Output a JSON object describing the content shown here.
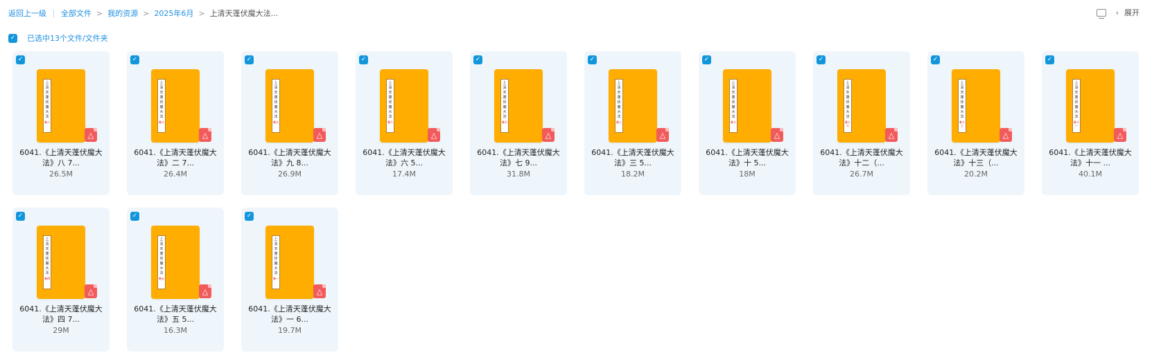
{
  "breadcrumb": {
    "back": "返回上一级",
    "items": [
      "全部文件",
      "我的资源",
      "2025年6月"
    ],
    "current": "上清天蓬伏魔大法..."
  },
  "toolbar": {
    "expand_label": "展开",
    "view_icon": "display-icon",
    "chevron_icon": "chevron-left-icon"
  },
  "selection": {
    "label": "已选中13个文件/文件夹",
    "checked": true
  },
  "colors": {
    "accent": "#1f8fe0",
    "checkbox": "#1296db",
    "card_bg": "#eef6fc",
    "book": "#ffad00",
    "pdf": "#f25b5b"
  },
  "files": [
    {
      "name_line1": "6041.《上清天蓬伏魔大",
      "name_line2": "法》八 7...",
      "size": "26.5M",
      "cover_title": "上清天蓬伏魔大法",
      "cover_vol": "卷八"
    },
    {
      "name_line1": "6041.《上清天蓬伏魔大",
      "name_line2": "法》二 7...",
      "size": "26.4M",
      "cover_title": "上清天蓬伏魔大法",
      "cover_vol": "卷二"
    },
    {
      "name_line1": "6041.《上清天蓬伏魔大",
      "name_line2": "法》九 8...",
      "size": "26.9M",
      "cover_title": "上清天蓬伏魔大法",
      "cover_vol": "卷九"
    },
    {
      "name_line1": "6041.《上清天蓬伏魔大",
      "name_line2": "法》六 5...",
      "size": "17.4M",
      "cover_title": "上清天蓬伏魔大法",
      "cover_vol": "卷六"
    },
    {
      "name_line1": "6041.《上清天蓬伏魔大",
      "name_line2": "法》七 9...",
      "size": "31.8M",
      "cover_title": "上清天蓬伏魔大法",
      "cover_vol": "卷七"
    },
    {
      "name_line1": "6041.《上清天蓬伏魔大",
      "name_line2": "法》三 5...",
      "size": "18.2M",
      "cover_title": "上清天蓬伏魔大法",
      "cover_vol": "卷三"
    },
    {
      "name_line1": "6041.《上清天蓬伏魔大",
      "name_line2": "法》十 5...",
      "size": "18M",
      "cover_title": "上清天蓬伏魔大法",
      "cover_vol": "卷十"
    },
    {
      "name_line1": "6041.《上清天蓬伏魔大",
      "name_line2": "法》十二（...",
      "size": "26.7M",
      "cover_title": "上清天蓬伏魔大法",
      "cover_vol": "卷十二"
    },
    {
      "name_line1": "6041.《上清天蓬伏魔大",
      "name_line2": "法》十三（...",
      "size": "20.2M",
      "cover_title": "上清天蓬伏魔大法",
      "cover_vol": "卷十三"
    },
    {
      "name_line1": "6041.《上清天蓬伏魔大",
      "name_line2": "法》十一 ...",
      "size": "40.1M",
      "cover_title": "上清天蓬伏魔大法",
      "cover_vol": "卷十一"
    },
    {
      "name_line1": "6041.《上清天蓬伏魔大",
      "name_line2": "法》四 7...",
      "size": "29M",
      "cover_title": "上清天蓬伏魔大法",
      "cover_vol": "卷四"
    },
    {
      "name_line1": "6041.《上清天蓬伏魔大",
      "name_line2": "法》五 5...",
      "size": "16.3M",
      "cover_title": "上清天蓬伏魔大法",
      "cover_vol": "卷五"
    },
    {
      "name_line1": "6041.《上清天蓬伏魔大",
      "name_line2": "法》一 6...",
      "size": "19.7M",
      "cover_title": "上清天蓬伏魔大法",
      "cover_vol": "卷一"
    }
  ]
}
